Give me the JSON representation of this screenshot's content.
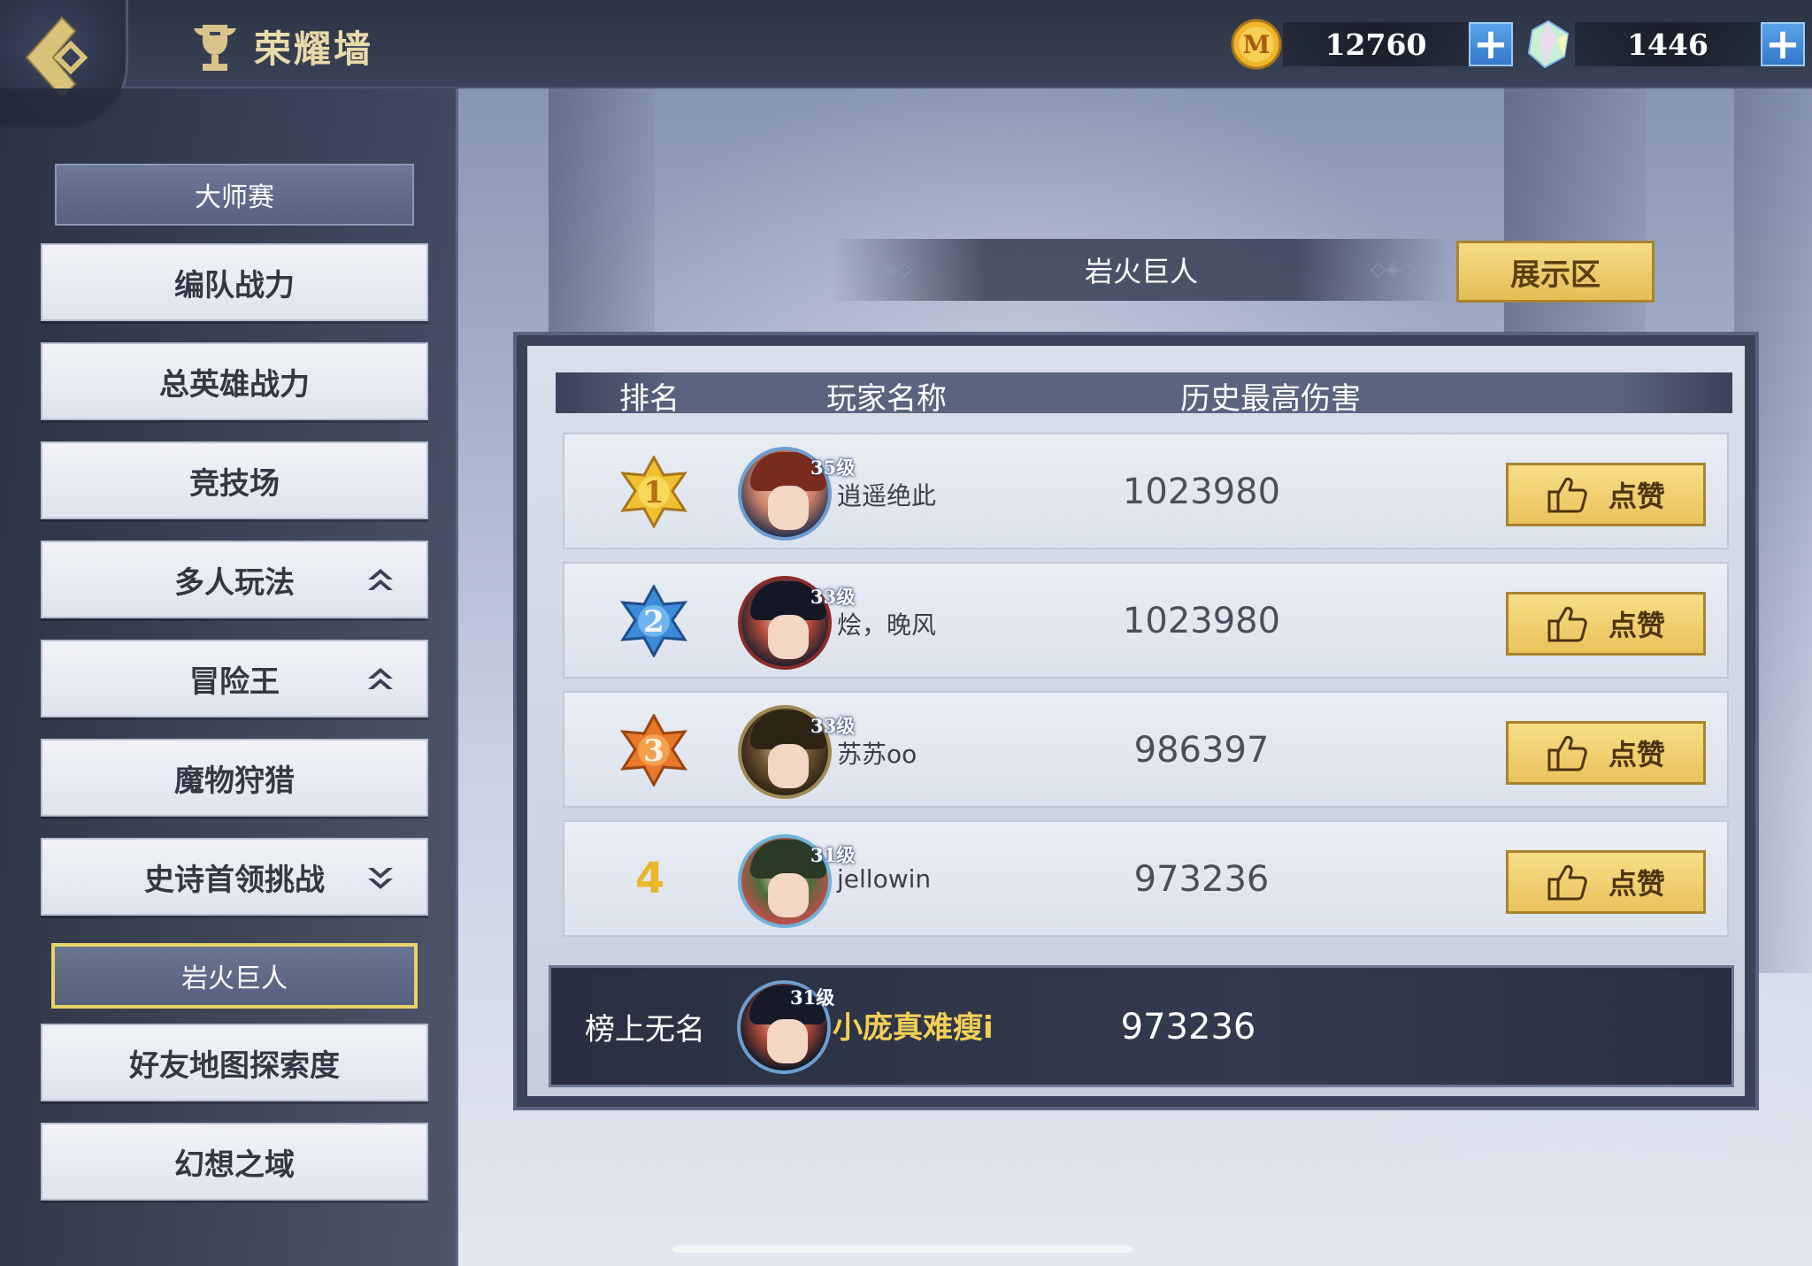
{
  "header": {
    "title": "荣耀墙",
    "coins": "12760",
    "gems": "1446"
  },
  "sidebar": {
    "section_label": "大师赛",
    "items": [
      {
        "label": "编队战力"
      },
      {
        "label": "总英雄战力"
      },
      {
        "label": "竞技场"
      },
      {
        "label": "多人玩法",
        "arrow": "up"
      },
      {
        "label": "冒险王",
        "arrow": "up"
      },
      {
        "label": "魔物狩猎"
      },
      {
        "label": "史诗首领挑战",
        "arrow": "down"
      }
    ],
    "selected_sub": "岩火巨人",
    "items_after": [
      {
        "label": "好友地图探索度"
      },
      {
        "label": "幻想之域"
      }
    ]
  },
  "main": {
    "section_title": "岩火巨人",
    "showcase_label": "展示区",
    "columns": {
      "rank": "排名",
      "player": "玩家名称",
      "damage": "历史最高伤害"
    },
    "like_label": "点赞",
    "rows": [
      {
        "rank": "1",
        "level": "35级",
        "name": "逍遥绝此",
        "damage": "1023980"
      },
      {
        "rank": "2",
        "level": "33级",
        "name": "烩，晚风",
        "damage": "1023980"
      },
      {
        "rank": "3",
        "level": "33级",
        "name": "苏苏oo",
        "damage": "986397"
      },
      {
        "rank": "4",
        "level": "31级",
        "name": "jellowin",
        "damage": "973236"
      }
    ],
    "self_row": {
      "rank_text": "榜上无名",
      "level": "31级",
      "name": "小庞真难瘦i",
      "damage": "973236"
    }
  },
  "colors": {
    "gold_button": "#e9c25c",
    "rank1": "#f0c030",
    "rank2": "#3d8ad6",
    "rank3": "#e8792a",
    "self_name": "#f2cf56"
  }
}
